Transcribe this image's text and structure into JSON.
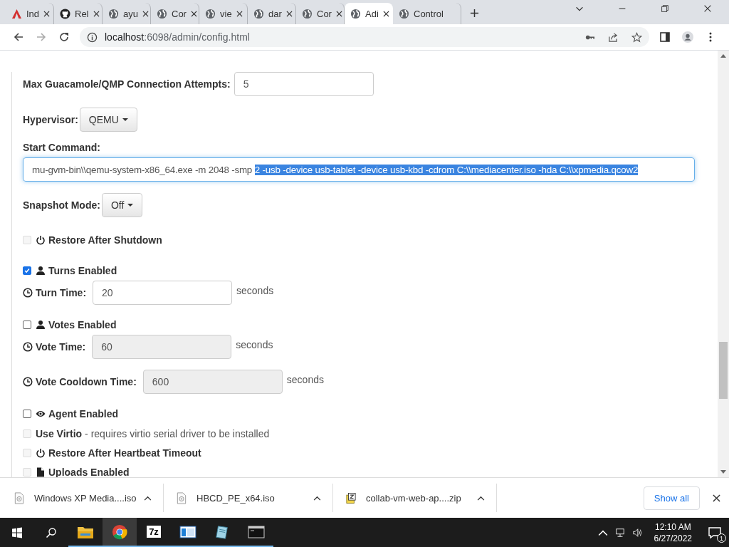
{
  "browser": {
    "tabs": [
      {
        "title": "Ind",
        "selected": false
      },
      {
        "title": "Rel",
        "selected": false
      },
      {
        "title": "ayu",
        "selected": false
      },
      {
        "title": "Cor",
        "selected": false
      },
      {
        "title": "vie",
        "selected": false
      },
      {
        "title": "dar",
        "selected": false
      },
      {
        "title": "Cor",
        "selected": false
      },
      {
        "title": "Adi",
        "selected": true
      },
      {
        "title": "Control",
        "selected": false
      }
    ],
    "address": {
      "host": "localhost",
      "rest": ":6098/admin/config.html"
    }
  },
  "form": [
    {
      "kind": "text-field",
      "label": "Max Guacamole/QMP Connection Attempts:",
      "value": "5",
      "disabled": false
    },
    {
      "kind": "dropdown",
      "label": "Hypervisor:",
      "value": "QEMU"
    },
    {
      "kind": "command",
      "label": "Start Command:",
      "value": "mu-gvm-bin\\\\qemu-system-x86_64.exe -m 2048 -smp ",
      "selected_text": "2 -usb -device usb-tablet -device usb-kbd -cdrom C:\\\\mediacenter.iso -hda C:\\\\xpmedia.qcow2"
    },
    {
      "kind": "dropdown",
      "label": "Snapshot Mode:",
      "value": "Off"
    },
    {
      "kind": "checkbox",
      "label": "Restore After Shutdown",
      "checked": false,
      "disabled": true
    },
    {
      "kind": "checkbox",
      "label": "Turns Enabled",
      "checked": true,
      "disabled": false
    },
    {
      "kind": "time-field",
      "label": "Turn Time:",
      "value": "20",
      "unit": "seconds",
      "disabled": false
    },
    {
      "kind": "checkbox",
      "label": "Votes Enabled",
      "checked": false,
      "disabled": false
    },
    {
      "kind": "time-field",
      "label": "Vote Time:",
      "value": "60",
      "unit": "seconds",
      "disabled": true
    },
    {
      "kind": "time-field",
      "label": "Vote Cooldown Time:",
      "value": "600",
      "unit": "seconds",
      "disabled": true
    },
    {
      "kind": "checkbox",
      "label": "Agent Enabled",
      "checked": false,
      "disabled": false
    },
    {
      "kind": "checkbox",
      "label": "Use Virtio",
      "note": "- requires virtio serial driver to be installed",
      "checked": false,
      "disabled": true
    },
    {
      "kind": "checkbox",
      "label": "Restore After Heartbeat Timeout",
      "checked": false,
      "disabled": true
    },
    {
      "kind": "checkbox",
      "label": "Uploads Enabled",
      "checked": false,
      "disabled": true
    }
  ],
  "downloads": {
    "items": [
      {
        "name": "Windows XP Media....iso"
      },
      {
        "name": "HBCD_PE_x64.iso"
      },
      {
        "name": "collab-vm-web-ap....zip"
      }
    ],
    "show_all": "Show all"
  },
  "taskbar": {
    "apps": [
      {
        "selected": false
      },
      {
        "selected": true
      },
      {
        "label": "7z",
        "selected": false
      },
      {
        "selected": false
      },
      {
        "selected": false
      },
      {
        "selected": false
      }
    ],
    "time": "12:10 AM",
    "date": "6/27/2022",
    "notifications": "1"
  }
}
